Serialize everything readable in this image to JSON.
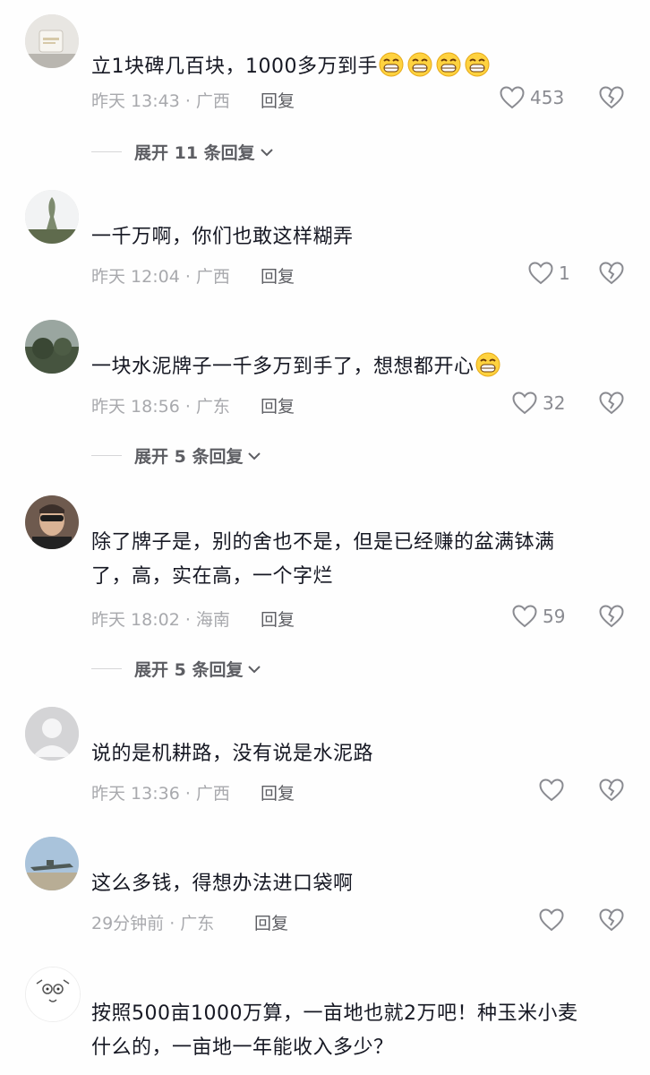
{
  "comments": [
    {
      "username": "",
      "text": "立1块碑几百块，1000多万到手",
      "emojis": [
        "grin-emoji",
        "grin-emoji",
        "grin-emoji",
        "grin-emoji"
      ],
      "time": "昨天 13:43 · 广西",
      "reply": "回复",
      "likes": "453",
      "expand": "展开 11 条回复"
    },
    {
      "username": "",
      "text": "一千万啊，你们也敢这样糊弄",
      "emojis": [],
      "time": "昨天 12:04 · 广西",
      "reply": "回复",
      "likes": "1",
      "expand": ""
    },
    {
      "username": "",
      "text": "一块水泥牌子一千多万到手了，想想都开心",
      "emojis": [
        "grin-emoji"
      ],
      "time": "昨天 18:56 · 广东",
      "reply": "回复",
      "likes": "32",
      "expand": "展开 5 条回复"
    },
    {
      "username": "",
      "text": "除了牌子是，别的舍也不是，但是已经赚的盆满钵满",
      "text2": "了，高，实在高，一个字烂",
      "emojis": [],
      "time": "昨天 18:02 · 海南",
      "reply": "回复",
      "likes": "59",
      "expand": "展开 5 条回复"
    },
    {
      "username": "",
      "text": "说的是机耕路，没有说是水泥路",
      "emojis": [],
      "time": "昨天 13:36 · 广西",
      "reply": "回复",
      "likes": "",
      "expand": ""
    },
    {
      "username": "",
      "text": "这么多钱，得想办法进口袋啊",
      "emojis": [],
      "time": "29分钟前 · 广东",
      "reply": "回复",
      "likes": "",
      "expand": ""
    },
    {
      "username": "",
      "text": "按照500亩1000万算，一亩地也就2万吧！种玉米小麦",
      "text2": "什么的，一亩地一年能收入多少？",
      "emojis": [],
      "time": "",
      "reply": "",
      "likes": "",
      "expand": ""
    }
  ],
  "colors": {
    "text": "#161823",
    "meta": "#a8a9ad",
    "reply": "#5d5e63",
    "icon": "#8a8b91"
  }
}
